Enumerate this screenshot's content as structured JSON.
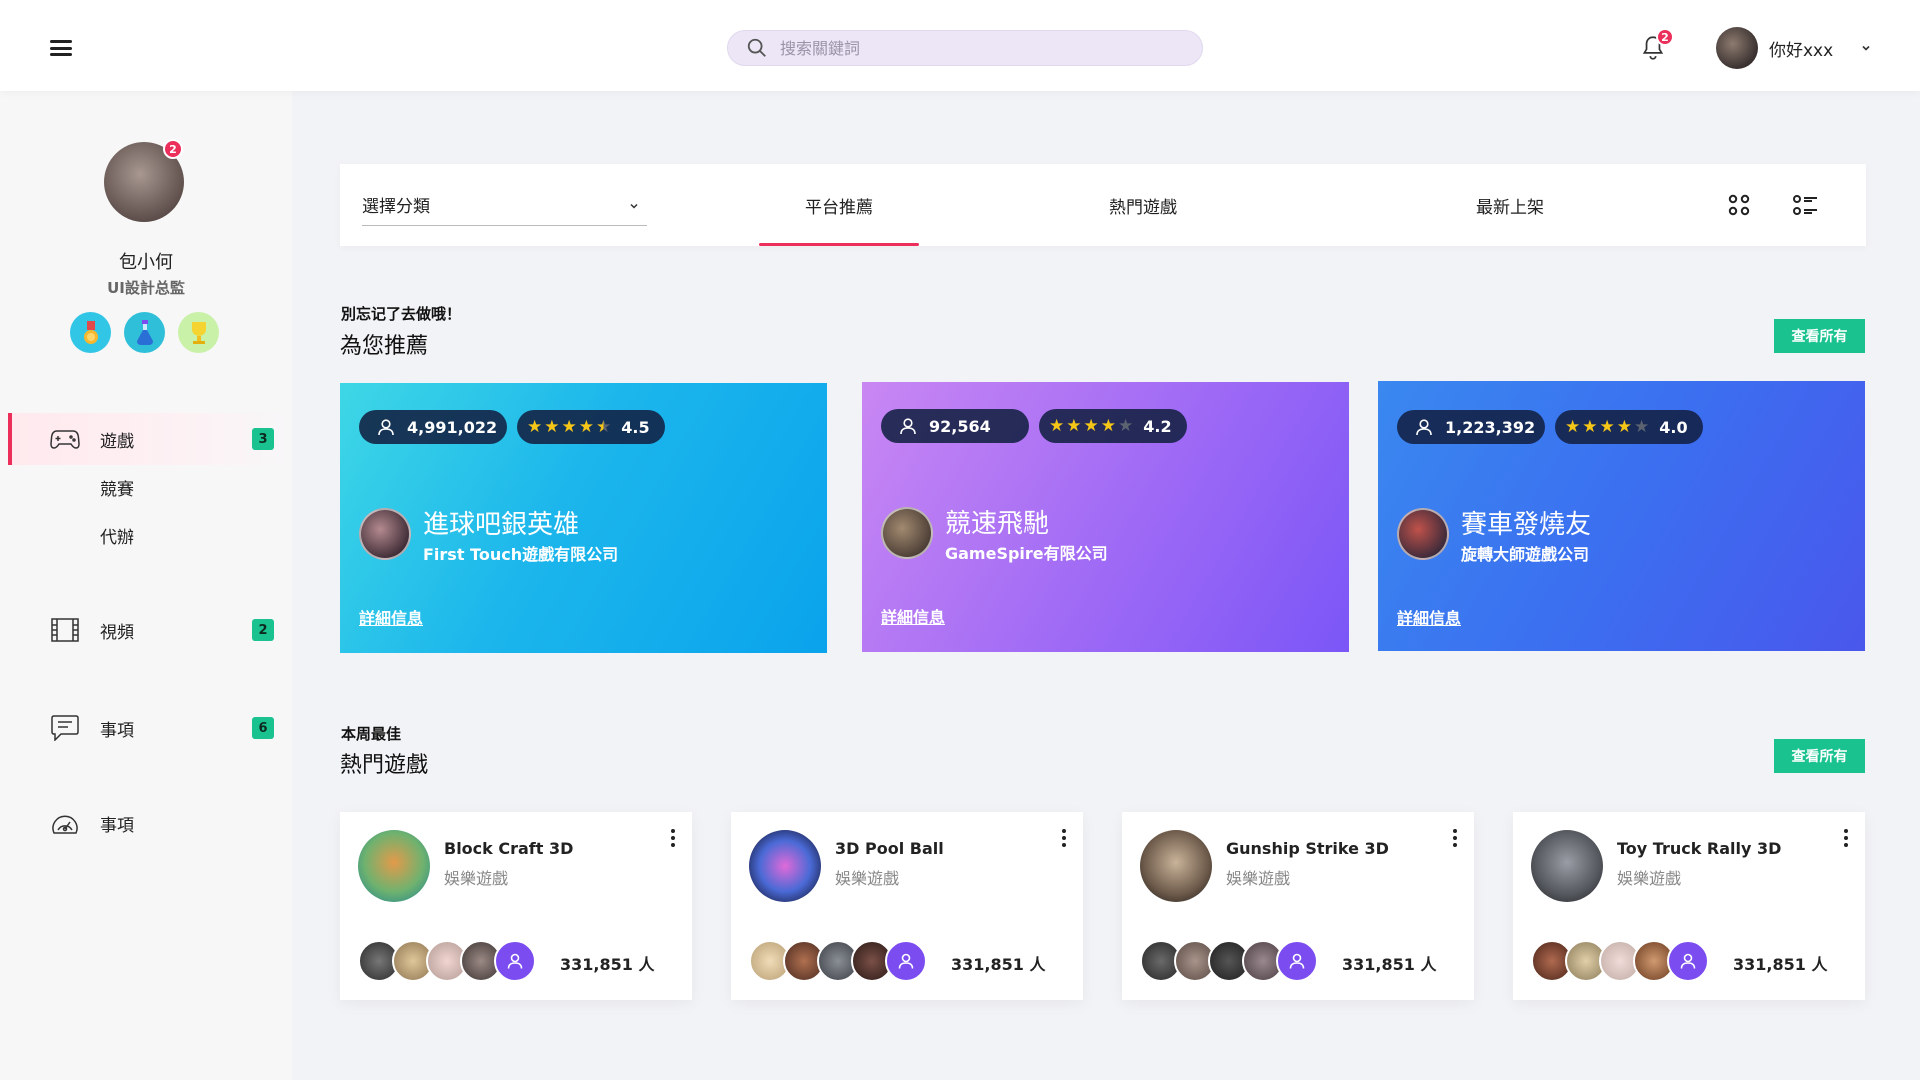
{
  "topbar": {
    "search_placeholder": "搜索關鍵詞",
    "notification_count": "2",
    "user_greeting": "你好xxx"
  },
  "profile": {
    "badge_count": "2",
    "name": "包小何",
    "title": "UI設計总監",
    "medals": [
      "medal-icon",
      "potion-icon",
      "trophy-icon"
    ]
  },
  "nav": {
    "games": {
      "label": "遊戲",
      "count": "3"
    },
    "sub": [
      "競賽",
      "代辦"
    ],
    "video": {
      "label": "視頻",
      "count": "2"
    },
    "events": {
      "label": "事項",
      "count": "6"
    },
    "events2": {
      "label": "事項"
    }
  },
  "filter": {
    "select_label": "選擇分類",
    "tabs": [
      "平台推薦",
      "熱門遊戲",
      "最新上架"
    ],
    "active_tab": 0
  },
  "recommend": {
    "kicker": "別忘记了去做哦！",
    "title": "為您推薦",
    "see_all": "查看所有",
    "cards": [
      {
        "users": "4,991,022",
        "rating": "4.5",
        "stars": 4.5,
        "title": "進球吧銀英雄",
        "developer": "First Touch遊戲有限公司",
        "link": "詳細信息",
        "accent": "#0aa3ec"
      },
      {
        "users": "92,564",
        "rating": "4.2",
        "stars": 4,
        "title": "競速飛馳",
        "developer": "GameSpire有限公司",
        "link": "詳細信息",
        "accent": "#8f5ff6"
      },
      {
        "users": "1,223,392",
        "rating": "4.0",
        "stars": 4,
        "title": "賽車發燒友",
        "developer": "旋轉大師遊戲公司",
        "link": "詳細信息",
        "accent": "#3b6ff0"
      }
    ]
  },
  "hot": {
    "kicker": "本周最佳",
    "title": "熱門遊戲",
    "see_all": "查看所有",
    "cards": [
      {
        "name": "Block Craft 3D",
        "category": "娛樂遊戲",
        "players": "331,851 人"
      },
      {
        "name": "3D Pool Ball",
        "category": "娛樂遊戲",
        "players": "331,851 人"
      },
      {
        "name": "Gunship Strike 3D",
        "category": "娛樂遊戲",
        "players": "331,851 人"
      },
      {
        "name": "Toy Truck Rally 3D",
        "category": "娛樂遊戲",
        "players": "331,851 人"
      }
    ]
  },
  "colors": {
    "accent_pink": "#ec2e5a",
    "accent_green": "#19c28f",
    "purple": "#7b4cf0"
  }
}
